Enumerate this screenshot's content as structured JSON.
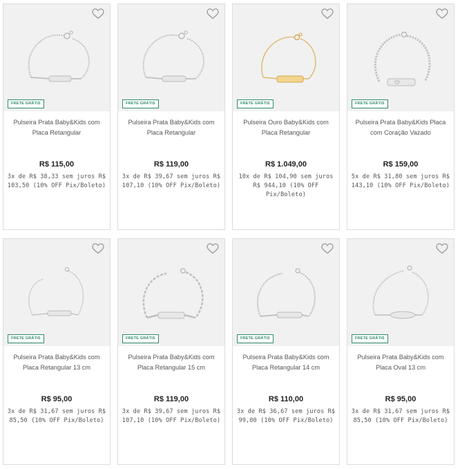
{
  "products": [
    {
      "badge": "FRETE GRÁTIS",
      "name": "Pulseira Prata Baby&Kids com Placa Retangular",
      "price": "R$ 115,00",
      "installments": "3x de R$ 38,33 sem juros R$ 103,50 (10% OFF Pix/Boleto)",
      "metal_color": "#c9c9c9",
      "icon": "silver-bracelet-image"
    },
    {
      "badge": "FRETE GRÁTIS",
      "name": "Pulseira Prata Baby&Kids com Placa Retangular",
      "price": "R$ 119,00",
      "installments": "3x de R$ 39,67 sem juros R$ 107,10 (10% OFF Pix/Boleto)",
      "metal_color": "#c9c9c9",
      "icon": "silver-bracelet-image"
    },
    {
      "badge": "FRETE GRÁTIS",
      "name": "Pulseira Ouro Baby&Kids com Placa Retangular",
      "price": "R$ 1.049,00",
      "installments": "10x de R$ 104,90 sem juros R$ 944,10 (10% OFF Pix/Boleto)",
      "metal_color": "#e3c172",
      "icon": "gold-bracelet-image"
    },
    {
      "badge": "FRETE GRÁTIS",
      "name": "Pulseira Prata Baby&Kids Placa com Coração Vazado",
      "price": "R$ 159,00",
      "installments": "5x de R$ 31,80 sem juros R$ 143,10 (10% OFF Pix/Boleto)",
      "metal_color": "#c9c9c9",
      "icon": "silver-bracelet-image"
    },
    {
      "badge": "FRETE GRÁTIS",
      "name": "Pulseira Prata Baby&Kids com Placa Retangular 13 cm",
      "price": "R$ 95,00",
      "installments": "3x de R$ 31,67 sem juros R$ 85,50 (10% OFF Pix/Boleto)",
      "metal_color": "#c9c9c9",
      "icon": "silver-bracelet-image"
    },
    {
      "badge": "FRETE GRÁTIS",
      "name": "Pulseira Prata Baby&Kids com Placa Retangular 15 cm",
      "price": "R$ 119,00",
      "installments": "3x de R$ 39,67 sem juros R$ 107,10 (10% OFF Pix/Boleto)",
      "metal_color": "#c9c9c9",
      "icon": "silver-bracelet-image"
    },
    {
      "badge": "FRETE GRÁTIS",
      "name": "Pulseira Prata Baby&Kids com Placa Retangular 14 cm",
      "price": "R$ 110,00",
      "installments": "3x de R$ 36,67 sem juros R$ 99,00 (10% OFF Pix/Boleto)",
      "metal_color": "#c9c9c9",
      "icon": "silver-bracelet-image"
    },
    {
      "badge": "FRETE GRÁTIS",
      "name": "Pulseira Prata Baby&Kids com Placa Oval 13 cm",
      "price": "R$ 95,00",
      "installments": "3x de R$ 31,67 sem juros R$ 85,50 (10% OFF Pix/Boleto)",
      "metal_color": "#c9c9c9",
      "icon": "silver-bracelet-image"
    }
  ],
  "colors": {
    "badge": "#2f8a6b",
    "image_background": "#f1f1f1",
    "border": "#dcdcdc"
  }
}
